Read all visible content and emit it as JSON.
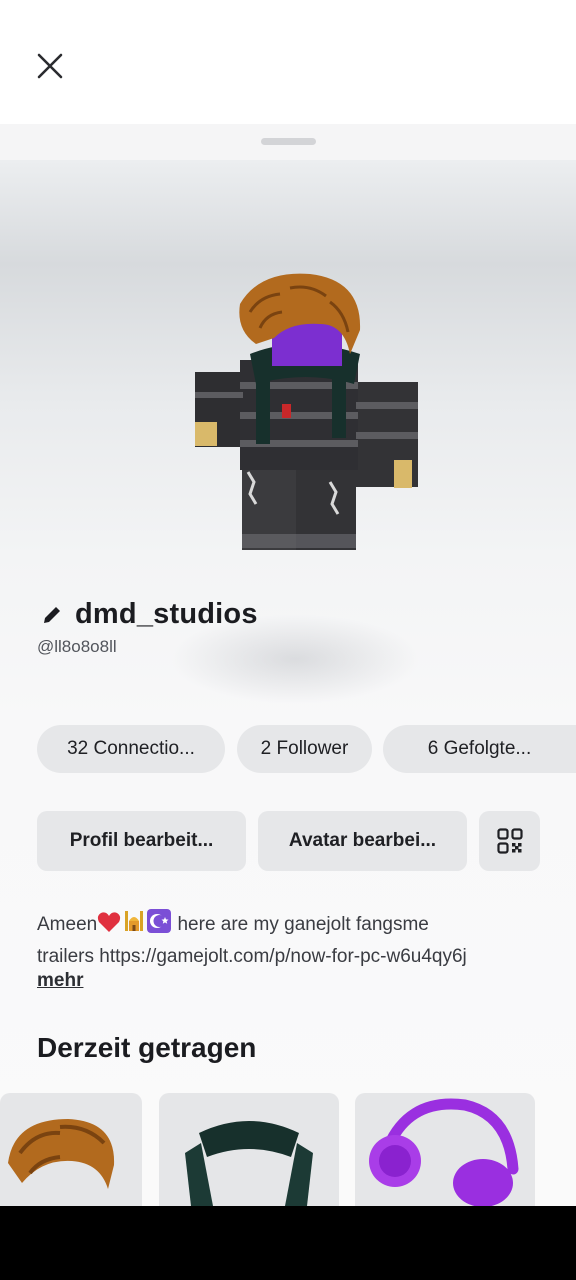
{
  "header": {
    "close_icon": "close-icon"
  },
  "profile": {
    "display_name": "dmd_studios",
    "username": "@ll8o8o8ll",
    "edit_icon": "pencil-icon"
  },
  "stats": [
    {
      "label": "32 Connectio..."
    },
    {
      "label": "2 Follower"
    },
    {
      "label": "6 Gefolgte..."
    }
  ],
  "actions": {
    "edit_profile": "Profil bearbeit...",
    "edit_avatar": "Avatar bearbei...",
    "qr_icon": "qr-code-icon"
  },
  "bio": {
    "line1_prefix": "Ameen",
    "line1_suffix": " here are my ganejolt fangsme",
    "line2": "trailers https://gamejolt.com/p/now-for-pc-w6u4qy6j",
    "emojis": [
      "heart-emoji",
      "mosque-emoji",
      "star-crescent-emoji"
    ],
    "more": "mehr"
  },
  "wearing": {
    "title": "Derzeit getragen",
    "items": [
      "hair-item",
      "scarf-item",
      "headphones-item"
    ]
  },
  "colors": {
    "chip_bg": "#e6e7e9",
    "heart": "#e0303f",
    "crescent_bg": "#7b4fd6",
    "headphones": "#9a2fe0",
    "hair": "#b26a1e"
  }
}
